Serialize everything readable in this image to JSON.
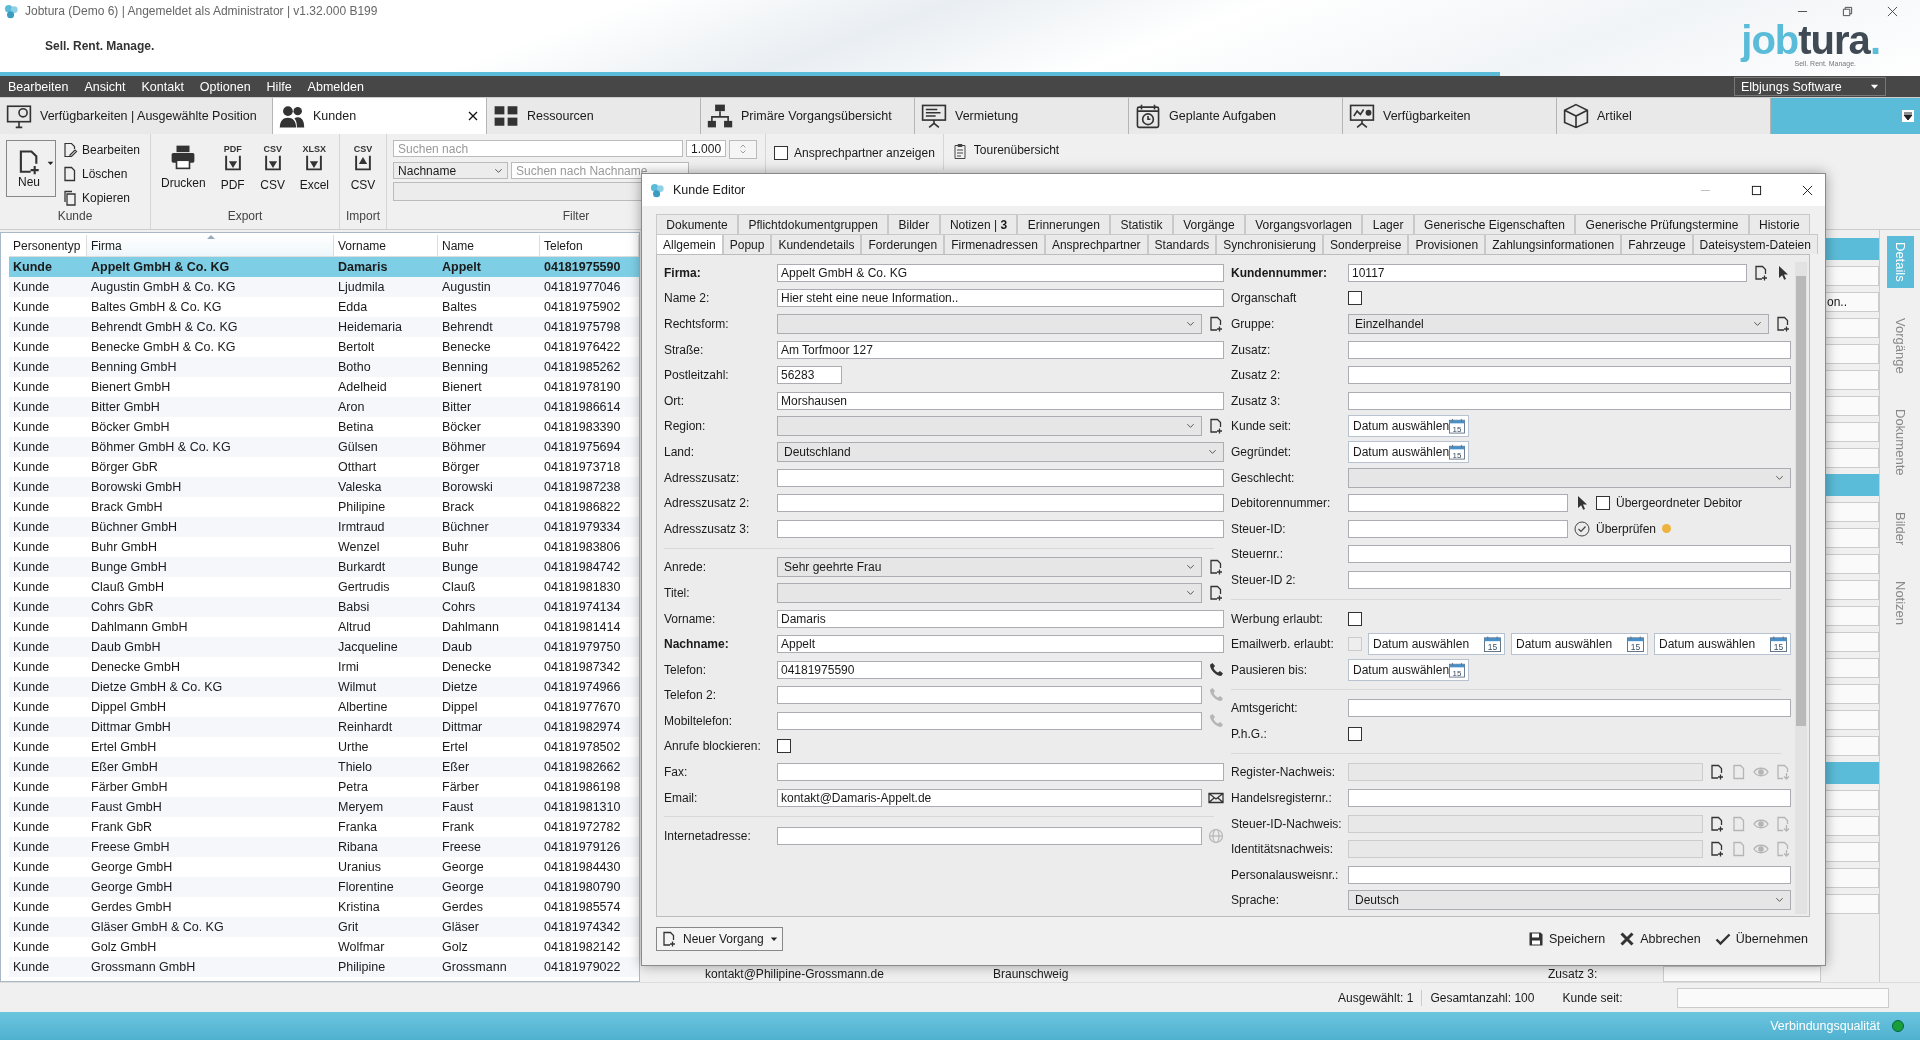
{
  "app": {
    "title": "Jobtura (Demo 6) | Angemeldet als Administrator | v1.32.000 B199",
    "slogan": "Sell. Rent. Manage.",
    "logo_first": "job",
    "logo_second": "tura",
    "logo_dot": ".",
    "logo_tagline": "Sell. Rent. Manage."
  },
  "menu": [
    "Bearbeiten",
    "Ansicht",
    "Kontakt",
    "Optionen",
    "Hilfe",
    "Abmelden"
  ],
  "company_select": "Elbjungs Software",
  "tabs": [
    {
      "label": "Verfügbarkeiten | Ausgewählte Position",
      "selected": false,
      "closable": false
    },
    {
      "label": "Kunden",
      "selected": true,
      "closable": true
    },
    {
      "label": "Ressourcen",
      "selected": false,
      "closable": false
    },
    {
      "label": "Primäre Vorgangsübersicht",
      "selected": false,
      "closable": false
    },
    {
      "label": "Vermietung",
      "selected": false,
      "closable": false
    },
    {
      "label": "Geplante Aufgaben",
      "selected": false,
      "closable": false
    },
    {
      "label": "Verfügbarkeiten",
      "selected": false,
      "closable": false
    },
    {
      "label": "Artikel",
      "selected": false,
      "closable": false
    }
  ],
  "ribbon": {
    "customer": {
      "title": "Kunde",
      "new": "Neu",
      "actions": [
        "Bearbeiten",
        "Löschen",
        "Kopieren"
      ]
    },
    "export": {
      "title": "Export",
      "buttons": [
        {
          "label": "Drucken"
        },
        {
          "label": "PDF",
          "tag": "PDF"
        },
        {
          "label": "CSV",
          "tag": "CSV"
        },
        {
          "label": "Excel",
          "tag": "XLSX"
        }
      ]
    },
    "import": {
      "title": "Import",
      "buttons": [
        {
          "label": "CSV",
          "tag": "CSV"
        }
      ]
    },
    "filter": {
      "title": "Filter",
      "search_placeholder": "Suchen nach",
      "count": "1.000",
      "field": "Nachname",
      "name_placeholder": "Suchen nach Nachname"
    },
    "contacts_option": {
      "label": "Ansprechpartner anzeigen",
      "checked": false
    },
    "tours": "Tourenübersicht"
  },
  "table": {
    "columns": [
      {
        "label": "Personentyp",
        "sorted": false
      },
      {
        "label": "Firma",
        "sorted": true
      },
      {
        "label": "Vorname",
        "sorted": false
      },
      {
        "label": "Name",
        "sorted": false
      },
      {
        "label": "Telefon",
        "sorted": false
      }
    ],
    "rows": [
      {
        "cells": [
          "Kunde",
          "Appelt GmbH & Co. KG",
          "Damaris",
          "Appelt",
          "04181975590"
        ],
        "selected": true
      },
      {
        "cells": [
          "Kunde",
          "Augustin GmbH & Co. KG",
          "Ljudmila",
          "Augustin",
          "04181977046"
        ],
        "selected": false
      },
      {
        "cells": [
          "Kunde",
          "Baltes GmbH & Co. KG",
          "Edda",
          "Baltes",
          "04181975902"
        ],
        "selected": false
      },
      {
        "cells": [
          "Kunde",
          "Behrendt GmbH & Co. KG",
          "Heidemaria",
          "Behrendt",
          "04181975798"
        ],
        "selected": false
      },
      {
        "cells": [
          "Kunde",
          "Benecke GmbH & Co. KG",
          "Bertolt",
          "Benecke",
          "04181976422"
        ],
        "selected": false
      },
      {
        "cells": [
          "Kunde",
          "Benning GmbH",
          "Botho",
          "Benning",
          "04181985262"
        ],
        "selected": false
      },
      {
        "cells": [
          "Kunde",
          "Bienert GmbH",
          "Adelheid",
          "Bienert",
          "04181978190"
        ],
        "selected": false
      },
      {
        "cells": [
          "Kunde",
          "Bitter GmbH",
          "Aron",
          "Bitter",
          "04181986614"
        ],
        "selected": false
      },
      {
        "cells": [
          "Kunde",
          "Böcker GmbH",
          "Betina",
          "Böcker",
          "04181983390"
        ],
        "selected": false
      },
      {
        "cells": [
          "Kunde",
          "Böhmer GmbH & Co. KG",
          "Gülsen",
          "Böhmer",
          "04181975694"
        ],
        "selected": false
      },
      {
        "cells": [
          "Kunde",
          "Börger GbR",
          "Otthart",
          "Börger",
          "04181973718"
        ],
        "selected": false
      },
      {
        "cells": [
          "Kunde",
          "Borowski GmbH",
          "Valeska",
          "Borowski",
          "04181987238"
        ],
        "selected": false
      },
      {
        "cells": [
          "Kunde",
          "Brack GmbH",
          "Philipine",
          "Brack",
          "04181986822"
        ],
        "selected": false
      },
      {
        "cells": [
          "Kunde",
          "Büchner GmbH",
          "Irmtraud",
          "Büchner",
          "04181979334"
        ],
        "selected": false
      },
      {
        "cells": [
          "Kunde",
          "Buhr GmbH",
          "Wenzel",
          "Buhr",
          "04181983806"
        ],
        "selected": false
      },
      {
        "cells": [
          "Kunde",
          "Bunge GmbH",
          "Burkardt",
          "Bunge",
          "04181984742"
        ],
        "selected": false
      },
      {
        "cells": [
          "Kunde",
          "Clauß GmbH",
          "Gertrudis",
          "Clauß",
          "04181981830"
        ],
        "selected": false
      },
      {
        "cells": [
          "Kunde",
          "Cohrs GbR",
          "Babsi",
          "Cohrs",
          "04181974134"
        ],
        "selected": false
      },
      {
        "cells": [
          "Kunde",
          "Dahlmann GmbH",
          "Altrud",
          "Dahlmann",
          "04181981414"
        ],
        "selected": false
      },
      {
        "cells": [
          "Kunde",
          "Daub GmbH",
          "Jacqueline",
          "Daub",
          "04181979750"
        ],
        "selected": false
      },
      {
        "cells": [
          "Kunde",
          "Denecke GmbH",
          "Irmi",
          "Denecke",
          "04181987342"
        ],
        "selected": false
      },
      {
        "cells": [
          "Kunde",
          "Dietze GmbH & Co. KG",
          "Wilmut",
          "Dietze",
          "04181974966"
        ],
        "selected": false
      },
      {
        "cells": [
          "Kunde",
          "Dippel GmbH",
          "Albertine",
          "Dippel",
          "04181977670"
        ],
        "selected": false
      },
      {
        "cells": [
          "Kunde",
          "Dittmar GmbH",
          "Reinhardt",
          "Dittmar",
          "04181982974"
        ],
        "selected": false
      },
      {
        "cells": [
          "Kunde",
          "Ertel GmbH",
          "Urthe",
          "Ertel",
          "04181978502"
        ],
        "selected": false
      },
      {
        "cells": [
          "Kunde",
          "Eßer GmbH",
          "Thielo",
          "Eßer",
          "04181982662"
        ],
        "selected": false
      },
      {
        "cells": [
          "Kunde",
          "Färber GmbH",
          "Petra",
          "Färber",
          "04181986198"
        ],
        "selected": false
      },
      {
        "cells": [
          "Kunde",
          "Faust GmbH",
          "Meryem",
          "Faust",
          "04181981310"
        ],
        "selected": false
      },
      {
        "cells": [
          "Kunde",
          "Frank GbR",
          "Franka",
          "Frank",
          "04181972782"
        ],
        "selected": false
      },
      {
        "cells": [
          "Kunde",
          "Freese GmbH",
          "Ribana",
          "Freese",
          "04181979126"
        ],
        "selected": false
      },
      {
        "cells": [
          "Kunde",
          "George GmbH",
          "Uranius",
          "George",
          "04181984430"
        ],
        "selected": false
      },
      {
        "cells": [
          "Kunde",
          "George GmbH",
          "Florentine",
          "George",
          "04181980790"
        ],
        "selected": false
      },
      {
        "cells": [
          "Kunde",
          "Gerdes GmbH",
          "Kristina",
          "Gerdes",
          "04181985574"
        ],
        "selected": false
      },
      {
        "cells": [
          "Kunde",
          "Gläser GmbH & Co. KG",
          "Grit",
          "Gläser",
          "04181974342"
        ],
        "selected": false
      },
      {
        "cells": [
          "Kunde",
          "Golz GmbH",
          "Wolfmar",
          "Golz",
          "04181982142"
        ],
        "selected": false
      },
      {
        "cells": [
          "Kunde",
          "Grossmann GmbH",
          "Philipine",
          "Grossmann",
          "04181979022"
        ],
        "selected": false
      }
    ]
  },
  "background": {
    "field_fragment": "on..",
    "row": [
      "kontakt@Philipine-Grossmann.de",
      "Braunschweig"
    ],
    "row_label": "Zusatz 3:",
    "status_label": "Kunde seit:"
  },
  "status": {
    "selected": "Ausgewählt: 1",
    "total": "Gesamtanzahl: 100"
  },
  "side_tabs": [
    {
      "label": "Details",
      "selected": true
    },
    {
      "label": "Vorgänge",
      "selected": false
    },
    {
      "label": "Dokumente",
      "selected": false
    },
    {
      "label": "Bilder",
      "selected": false
    },
    {
      "label": "Notizen",
      "selected": false
    }
  ],
  "footer": {
    "connection": "Verbindungsqualität",
    "connection_ok": true
  },
  "editor": {
    "title": "Kunde Editor",
    "tab_rows": [
      [
        {
          "label": "Dokumente",
          "selected": false
        },
        {
          "label": "Pflichtdokumentgruppen",
          "selected": false
        },
        {
          "label": "Bilder",
          "selected": false
        },
        {
          "label": "Notizen | **3**",
          "selected": false
        },
        {
          "label": "Erinnerungen",
          "selected": false
        },
        {
          "label": "Statistik",
          "selected": false
        },
        {
          "label": "Vorgänge",
          "selected": false
        },
        {
          "label": "Vorgangsvorlagen",
          "selected": false
        },
        {
          "label": "Lager",
          "selected": false
        },
        {
          "label": "Generische Eigenschaften",
          "selected": false
        },
        {
          "label": "Generische Prüfungstermine",
          "selected": false
        },
        {
          "label": "Historie",
          "selected": false
        }
      ],
      [
        {
          "label": "Allgemein",
          "selected": true
        },
        {
          "label": "Popup",
          "selected": false
        },
        {
          "label": "Kundendetails",
          "selected": false
        },
        {
          "label": "Forderungen",
          "selected": false
        },
        {
          "label": "Firmenadressen",
          "selected": false
        },
        {
          "label": "Ansprechpartner",
          "selected": false
        },
        {
          "label": "Standards",
          "selected": false
        },
        {
          "label": "Synchronisierung",
          "selected": false
        },
        {
          "label": "Sonderpreise",
          "selected": false
        },
        {
          "label": "Provisionen",
          "selected": false
        },
        {
          "label": "Zahlungsinformationen",
          "selected": false
        },
        {
          "label": "Fahrzeuge",
          "selected": false
        },
        {
          "label": "Dateisystem-Dateien",
          "selected": false
        }
      ]
    ],
    "left_groups": [
      [
        {
          "kind": "text",
          "label": "Firma:",
          "bold": true,
          "value": "Appelt GmbH & Co. KG"
        },
        {
          "kind": "text",
          "label": "Name 2:",
          "value": "Hier steht eine neue Information.."
        },
        {
          "kind": "combo",
          "label": "Rechtsform:",
          "icons": [
            {
              "kind": "add"
            }
          ]
        },
        {
          "kind": "text",
          "label": "Straße:",
          "value": "Am Torfmoor 127"
        },
        {
          "kind": "short",
          "label": "Postleitzahl:",
          "value": "56283"
        },
        {
          "kind": "text",
          "label": "Ort:",
          "value": "Morshausen"
        },
        {
          "kind": "combo",
          "label": "Region:",
          "icons": [
            {
              "kind": "add"
            }
          ]
        },
        {
          "kind": "combo",
          "label": "Land:",
          "value": "Deutschland"
        },
        {
          "kind": "text",
          "label": "Adresszusatz:"
        },
        {
          "kind": "text",
          "label": "Adresszusatz 2:"
        },
        {
          "kind": "text",
          "label": "Adresszusatz 3:"
        }
      ],
      [
        {
          "kind": "combo",
          "label": "Anrede:",
          "value": "Sehr geehrte Frau",
          "icons": [
            {
              "kind": "add"
            }
          ]
        },
        {
          "kind": "combo",
          "label": "Titel:",
          "icons": [
            {
              "kind": "add"
            }
          ]
        },
        {
          "kind": "text",
          "label": "Vorname:",
          "value": "Damaris"
        },
        {
          "kind": "text",
          "label": "Nachname:",
          "bold": true,
          "value": "Appelt"
        },
        {
          "kind": "text",
          "label": "Telefon:",
          "value": "04181975590",
          "icons": [
            {
              "kind": "phone"
            }
          ]
        },
        {
          "kind": "text",
          "label": "Telefon 2:",
          "icons": [
            {
              "kind": "phone",
              "disabled": true
            }
          ]
        },
        {
          "kind": "text",
          "label": "Mobiltelefon:",
          "icons": [
            {
              "kind": "phone",
              "disabled": true
            }
          ]
        },
        {
          "kind": "check",
          "label": "Anrufe blockieren:",
          "checked": false
        },
        {
          "kind": "text",
          "label": "Fax:"
        },
        {
          "kind": "text",
          "label": "Email:",
          "value": "kontakt@Damaris-Appelt.de",
          "icons": [
            {
              "kind": "mail"
            }
          ]
        }
      ],
      [
        {
          "kind": "text",
          "label": "Internetadresse:",
          "icons": [
            {
              "kind": "globe",
              "disabled": true
            }
          ]
        }
      ]
    ],
    "right_groups": [
      [
        {
          "kind": "text",
          "label": "Kundennummer:",
          "bold": true,
          "value": "10117",
          "icons": [
            {
              "kind": "add"
            },
            {
              "kind": "pick"
            }
          ]
        },
        {
          "kind": "check",
          "label": "Organschaft",
          "checked": false
        },
        {
          "kind": "combo",
          "label": "Gruppe:",
          "value": "Einzelhandel",
          "icons": [
            {
              "kind": "add"
            }
          ]
        },
        {
          "kind": "text",
          "label": "Zusatz:"
        },
        {
          "kind": "text",
          "label": "Zusatz 2:"
        },
        {
          "kind": "text",
          "label": "Zusatz 3:"
        },
        {
          "kind": "date",
          "label": "Kunde seit:",
          "date": {
            "placeholder": "Datum auswählen",
            "day": "15"
          }
        },
        {
          "kind": "date",
          "label": "Gegründet:",
          "date": {
            "placeholder": "Datum auswählen",
            "day": "15"
          }
        },
        {
          "kind": "combo",
          "label": "Geschlecht:"
        },
        {
          "kind": "narrow",
          "label": "Debitorennummer:",
          "icons": [
            {
              "kind": "pick"
            }
          ],
          "option": {
            "label": "Übergeordneter Debitor",
            "checked": false
          }
        },
        {
          "kind": "narrow",
          "label": "Steuer-ID:",
          "verify": {
            "label": "Überprüfen",
            "color": "#eeb33f"
          }
        },
        {
          "kind": "text",
          "label": "Steuernr.:"
        },
        {
          "kind": "text",
          "label": "Steuer-ID 2:"
        }
      ],
      [
        {
          "kind": "check",
          "label": "Werbung erlaubt:",
          "checked": false
        },
        {
          "kind": "dates",
          "label": "Emailwerb. erlaubt:",
          "check": {
            "checked": false,
            "disabled": true
          },
          "dates": [
            {
              "placeholder": "Datum auswählen",
              "day": "15"
            },
            {
              "placeholder": "Datum auswählen",
              "day": "15"
            },
            {
              "placeholder": "Datum auswählen",
              "day": "15"
            }
          ]
        },
        {
          "kind": "date",
          "label": "Pausieren bis:",
          "date": {
            "placeholder": "Datum auswählen",
            "day": "15"
          }
        }
      ],
      [
        {
          "kind": "text",
          "label": "Amtsgericht:"
        },
        {
          "kind": "check",
          "label": "P.h.G.:",
          "checked": false
        }
      ],
      [
        {
          "kind": "file",
          "label": "Register-Nachweis:",
          "icons": [
            {
              "kind": "add"
            },
            {
              "kind": "doc",
              "disabled": true
            },
            {
              "kind": "eye",
              "disabled": true
            },
            {
              "kind": "download",
              "disabled": true
            }
          ]
        },
        {
          "kind": "text",
          "label": "Handelsregisternr.:"
        },
        {
          "kind": "file",
          "label": "Steuer-ID-Nachweis:",
          "icons": [
            {
              "kind": "add"
            },
            {
              "kind": "doc",
              "disabled": true
            },
            {
              "kind": "eye",
              "disabled": true
            },
            {
              "kind": "download",
              "disabled": true
            }
          ]
        },
        {
          "kind": "file",
          "label": "Identitätsnachweis:",
          "icons": [
            {
              "kind": "add"
            },
            {
              "kind": "doc",
              "disabled": true
            },
            {
              "kind": "eye",
              "disabled": true
            },
            {
              "kind": "download",
              "disabled": true
            }
          ]
        },
        {
          "kind": "text",
          "label": "Personalausweisnr.:"
        },
        {
          "kind": "combo",
          "label": "Sprache:",
          "value": "Deutsch"
        }
      ]
    ],
    "new_process": "Neuer Vorgang",
    "actions": [
      "Speichern",
      "Abbrechen",
      "Übernehmen"
    ]
  }
}
